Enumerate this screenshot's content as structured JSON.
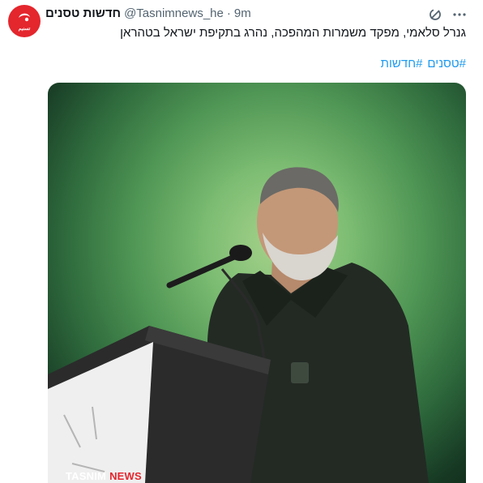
{
  "header": {
    "display_name": "חדשות טסנים",
    "handle": "@Tasnimnews_he",
    "separator": "·",
    "time": "9m"
  },
  "avatar": {
    "logo_text": "تسنیم"
  },
  "tweet": {
    "text": "גנרל סלאמי, מפקד משמרות המהפכה, נהרג בתקיפת ישראל בטהראן",
    "hashtags": [
      "#טסנים",
      "#חדשות"
    ]
  },
  "media": {
    "watermark_part1": "TASNIM",
    "watermark_part2": "NEWS"
  },
  "icons": {
    "grok": "grok-icon",
    "more": "more-icon"
  },
  "colors": {
    "link": "#1d9bf0",
    "brand_red": "#e4262d",
    "text": "#0f1419",
    "muted": "#536471"
  }
}
